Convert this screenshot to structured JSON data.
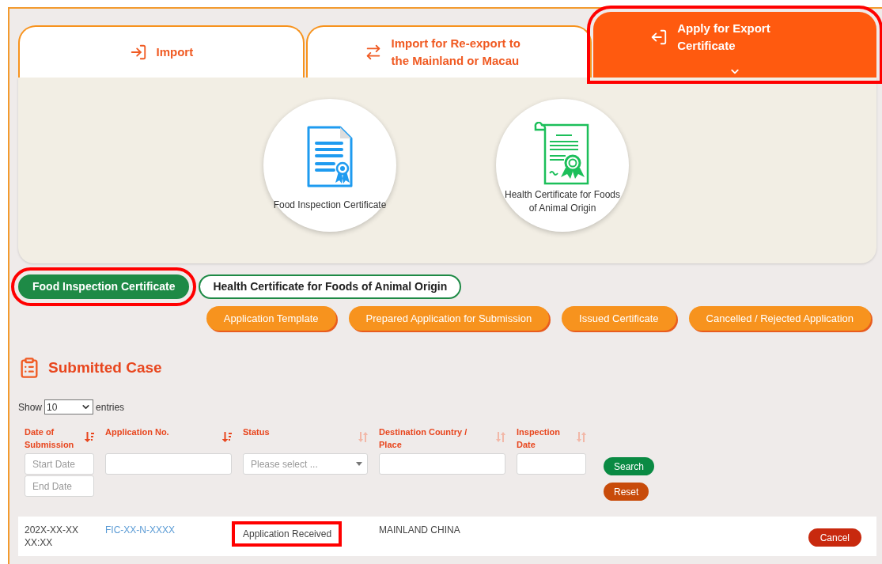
{
  "nav_tabs": [
    {
      "label": "Import",
      "kind": "import",
      "selected": false,
      "highlighted": false
    },
    {
      "label": "Import for Re-export to the Mainland or Macau",
      "kind": "reexport",
      "selected": false,
      "highlighted": false
    },
    {
      "label": "Apply for Export Certificate",
      "kind": "export",
      "selected": true,
      "highlighted": true
    }
  ],
  "certificate_cards": [
    {
      "label": "Food Inspection Certificate",
      "kind": "food"
    },
    {
      "label": "Health Certificate for Foods of Animal Origin",
      "kind": "health"
    }
  ],
  "certificate_tabs": [
    {
      "label": "Food Inspection Certificate",
      "selected": true,
      "highlighted": true
    },
    {
      "label": "Health Certificate for Foods of Animal Origin",
      "selected": false,
      "highlighted": false
    }
  ],
  "action_buttons": [
    "Application Template",
    "Prepared Application for Submission",
    "Issued Certificate",
    "Cancelled / Rejected Application"
  ],
  "section_title": "Submitted Case",
  "entries": {
    "prefix": "Show",
    "value": "10",
    "suffix": "entries"
  },
  "table": {
    "columns": [
      {
        "label": "Date of Submission",
        "sorted": true,
        "filter": {
          "kind": "date_range",
          "placeholders": [
            "Start Date",
            "End Date"
          ]
        }
      },
      {
        "label": "Application No.",
        "sorted": true,
        "filter": {
          "kind": "text"
        }
      },
      {
        "label": "Status",
        "sorted": false,
        "filter": {
          "kind": "select",
          "placeholder": "Please select ..."
        }
      },
      {
        "label": "Destination Country / Place",
        "sorted": false,
        "filter": {
          "kind": "text"
        }
      },
      {
        "label": "Inspection Date",
        "sorted": false,
        "filter": {
          "kind": "text"
        }
      }
    ],
    "search_button": "Search",
    "reset_button": "Reset",
    "rows": [
      {
        "date": "202X-XX-XX XX:XX",
        "application_no": "FIC-XX-N-XXXX",
        "status": "Application Received",
        "status_highlighted": true,
        "destination": "MAINLAND CHINA",
        "action": "Cancel"
      }
    ]
  }
}
